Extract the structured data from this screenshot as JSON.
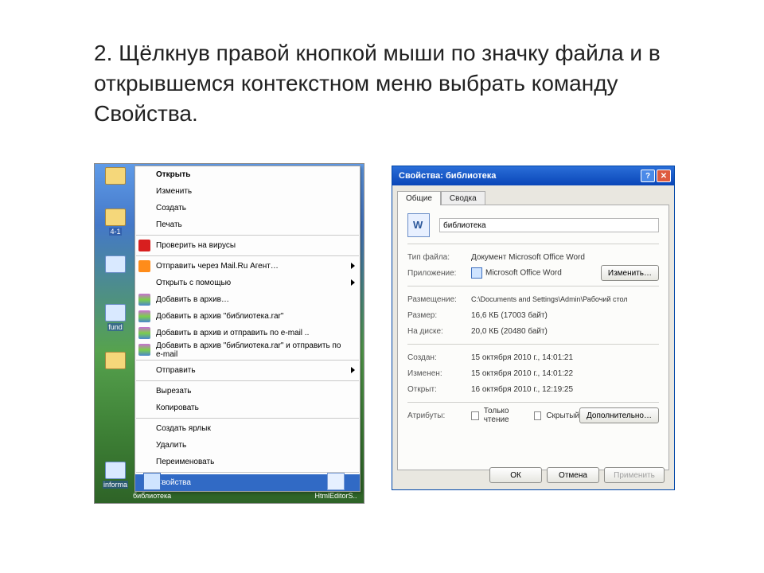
{
  "slide": {
    "text": "2. Щёлкнув правой кнопкой мыши по значку файла и в открывшемся контекстном меню выбрать команду Свойства."
  },
  "desktop": {
    "icons": [
      "",
      "4-1",
      "",
      "fund",
      "",
      "informa"
    ],
    "shortcut1": "библиотека",
    "shortcut2": "HtmlEditorS.."
  },
  "contextMenu": [
    {
      "label": "Открыть",
      "bold": true
    },
    {
      "label": "Изменить"
    },
    {
      "label": "Создать"
    },
    {
      "label": "Печать"
    },
    {
      "sep": true
    },
    {
      "label": "Проверить на вирусы",
      "icon": "k"
    },
    {
      "sep": true
    },
    {
      "label": "Отправить через Mail.Ru Агент…",
      "icon": "m",
      "sub": true
    },
    {
      "label": "Открыть с помощью",
      "sub": true
    },
    {
      "label": "Добавить в архив…",
      "icon": "rar"
    },
    {
      "label": "Добавить в архив \"библиотека.rar\"",
      "icon": "rar"
    },
    {
      "label": "Добавить в архив и отправить по e-mail ..",
      "icon": "rar"
    },
    {
      "label": "Добавить в архив \"библиотека.rar\" и отправить по e-mail",
      "icon": "rar"
    },
    {
      "sep": true
    },
    {
      "label": "Отправить",
      "sub": true
    },
    {
      "sep": true
    },
    {
      "label": "Вырезать"
    },
    {
      "label": "Копировать"
    },
    {
      "sep": true
    },
    {
      "label": "Создать ярлык"
    },
    {
      "label": "Удалить"
    },
    {
      "label": "Переименовать"
    },
    {
      "sep": true
    },
    {
      "label": "Свойства",
      "sel": true
    }
  ],
  "props": {
    "title": "Свойства: библиотека",
    "tabs": {
      "general": "Общие",
      "summary": "Сводка"
    },
    "filename": "библиотека",
    "rows": {
      "type_l": "Тип файла:",
      "type_v": "Документ Microsoft Office Word",
      "app_l": "Приложение:",
      "app_v": "Microsoft Office Word",
      "change_btn": "Изменить…",
      "loc_l": "Размещение:",
      "loc_v": "C:\\Documents and Settings\\Admin\\Рабочий стол",
      "size_l": "Размер:",
      "size_v": "16,6 КБ (17003 байт)",
      "disk_l": "На диске:",
      "disk_v": "20,0 КБ (20480 байт)",
      "created_l": "Создан:",
      "created_v": "15 октября 2010 г., 14:01:21",
      "modified_l": "Изменен:",
      "modified_v": "15 октября 2010 г., 14:01:22",
      "opened_l": "Открыт:",
      "opened_v": "16 октября 2010 г., 12:19:25",
      "attrs_l": "Атрибуты:",
      "readonly": "Только чтение",
      "hidden": "Скрытый",
      "advanced": "Дополнительно…"
    },
    "buttons": {
      "ok": "ОК",
      "cancel": "Отмена",
      "apply": "Применить"
    }
  }
}
